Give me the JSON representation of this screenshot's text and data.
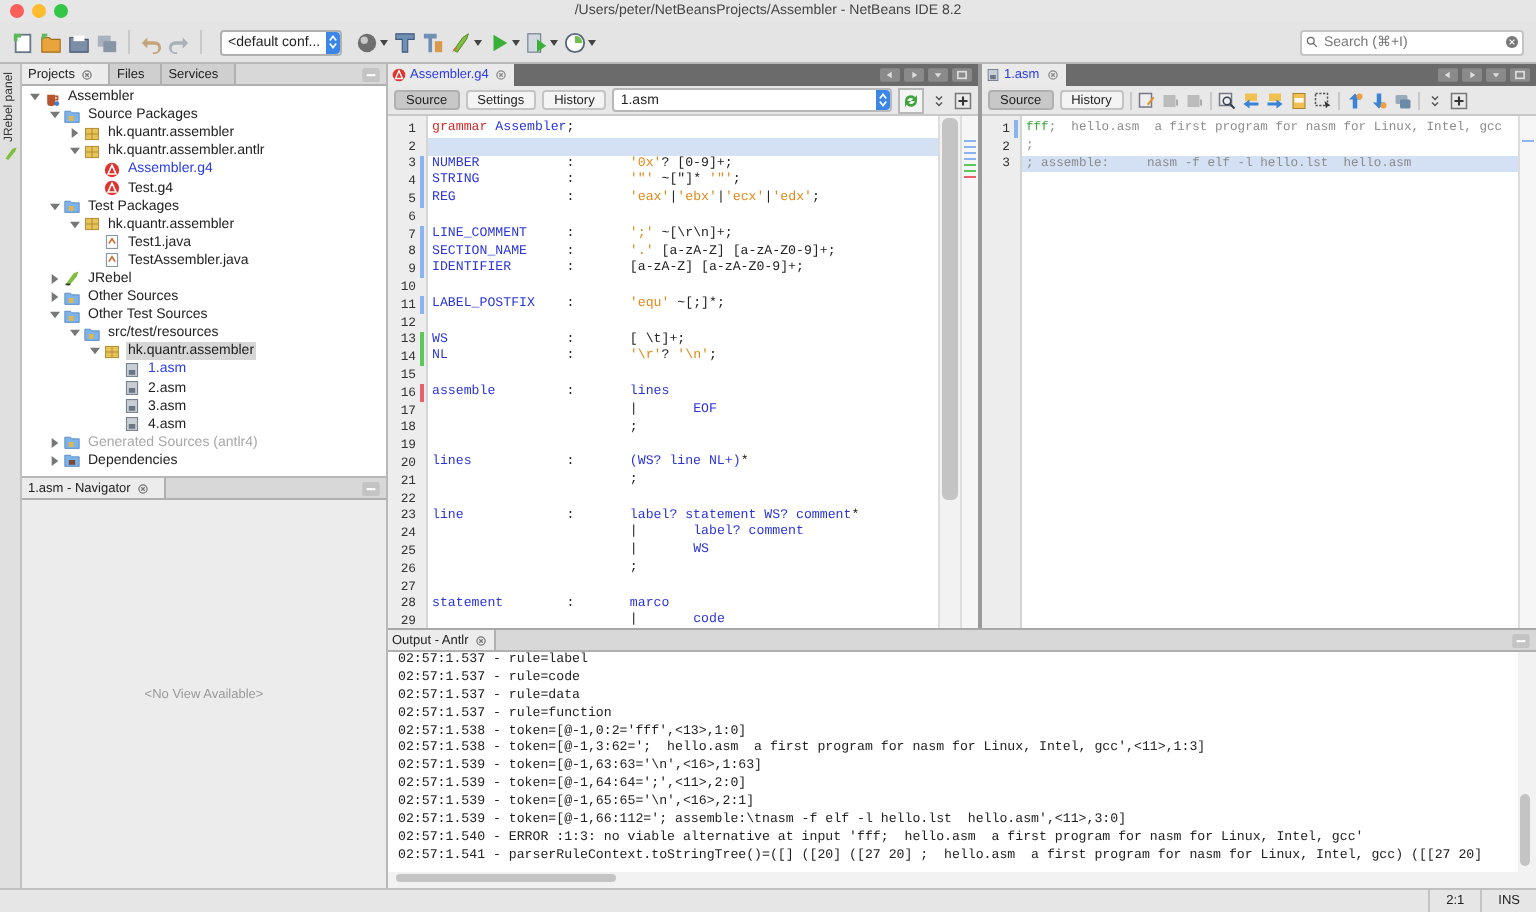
{
  "window": {
    "title": "/Users/peter/NetBeansProjects/Assembler - NetBeans IDE 8.2"
  },
  "toolbar": {
    "configuration": "<default conf...",
    "search": {
      "placeholder": "Search (⌘+I)"
    }
  },
  "side_strip": {
    "label": "JRebel panel"
  },
  "projects_panel": {
    "tabs": [
      {
        "label": "Projects",
        "selected": true
      },
      {
        "label": "Files",
        "selected": false
      },
      {
        "label": "Services",
        "selected": false
      }
    ],
    "tree": [
      {
        "label": "Assembler",
        "kind": "project",
        "expanded": true,
        "selected": false,
        "open": false,
        "disabled": false,
        "children": [
          {
            "label": "Source Packages",
            "kind": "folder",
            "expanded": true,
            "selected": false,
            "open": false,
            "disabled": false,
            "children": [
              {
                "label": "hk.quantr.assembler",
                "kind": "package",
                "expanded": false,
                "selected": false,
                "open": false,
                "disabled": false
              },
              {
                "label": "hk.quantr.assembler.antlr",
                "kind": "package",
                "expanded": true,
                "selected": false,
                "open": false,
                "disabled": false,
                "children": [
                  {
                    "label": "Assembler.g4",
                    "kind": "grammar",
                    "selected": false,
                    "open": true,
                    "disabled": false
                  },
                  {
                    "label": "Test.g4",
                    "kind": "grammar",
                    "selected": false,
                    "open": false,
                    "disabled": false
                  }
                ]
              }
            ]
          },
          {
            "label": "Test Packages",
            "kind": "folder",
            "expanded": true,
            "selected": false,
            "open": false,
            "disabled": false,
            "children": [
              {
                "label": "hk.quantr.assembler",
                "kind": "package",
                "expanded": true,
                "selected": false,
                "open": false,
                "disabled": false,
                "children": [
                  {
                    "label": "Test1.java",
                    "kind": "java",
                    "selected": false,
                    "open": false,
                    "disabled": false
                  },
                  {
                    "label": "TestAssembler.java",
                    "kind": "java",
                    "selected": false,
                    "open": false,
                    "disabled": false
                  }
                ]
              }
            ]
          },
          {
            "label": "JRebel",
            "kind": "jrebel",
            "expanded": false,
            "selected": false,
            "open": false,
            "disabled": false
          },
          {
            "label": "Other Sources",
            "kind": "folder",
            "expanded": false,
            "selected": false,
            "open": false,
            "disabled": false
          },
          {
            "label": "Other Test Sources",
            "kind": "folder",
            "expanded": true,
            "selected": false,
            "open": false,
            "disabled": false,
            "children": [
              {
                "label": "src/test/resources",
                "kind": "folder",
                "expanded": true,
                "selected": false,
                "open": false,
                "disabled": false,
                "children": [
                  {
                    "label": "hk.quantr.assembler",
                    "kind": "package",
                    "expanded": true,
                    "selected": true,
                    "open": false,
                    "disabled": false,
                    "children": [
                      {
                        "label": "1.asm",
                        "kind": "asm",
                        "selected": false,
                        "open": true,
                        "disabled": false
                      },
                      {
                        "label": "2.asm",
                        "kind": "asm",
                        "selected": false,
                        "open": false,
                        "disabled": false
                      },
                      {
                        "label": "3.asm",
                        "kind": "asm",
                        "selected": false,
                        "open": false,
                        "disabled": false
                      },
                      {
                        "label": "4.asm",
                        "kind": "asm",
                        "selected": false,
                        "open": false,
                        "disabled": false
                      }
                    ]
                  }
                ]
              }
            ]
          },
          {
            "label": "Generated Sources (antlr4)",
            "kind": "folder",
            "expanded": false,
            "selected": false,
            "open": false,
            "disabled": true
          },
          {
            "label": "Dependencies",
            "kind": "library",
            "expanded": false,
            "selected": false,
            "open": false,
            "disabled": false
          }
        ]
      }
    ]
  },
  "navigator": {
    "title": "1.asm - Navigator",
    "message": "<No View Available>"
  },
  "editors": [
    {
      "tab": "Assembler.g4",
      "kind": "grammar",
      "views": [
        {
          "label": "Source",
          "selected": true
        },
        {
          "label": "Settings",
          "selected": false
        },
        {
          "label": "History",
          "selected": false
        }
      ],
      "file_selector": "1.asm",
      "lines": [
        {
          "n": "1",
          "current": false,
          "segments": [
            {
              "kind": "keyword",
              "text": "grammar"
            },
            {
              "kind": "name",
              "text": "Assembler"
            },
            {
              "kind": "plain",
              "text": ";"
            }
          ]
        },
        {
          "n": "2",
          "current": true
        },
        {
          "n": "3",
          "current": false,
          "color": "#8ab4f0",
          "name": "NUMBER",
          "colon": ":",
          "segments": [
            {
              "kind": "string",
              "text": "'0x'"
            },
            {
              "kind": "plain",
              "text": "? [0-9]+;"
            }
          ]
        },
        {
          "n": "4",
          "current": false,
          "color": "#8ab4f0",
          "name": "STRING",
          "colon": ":",
          "segments": [
            {
              "kind": "string",
              "text": "'\"'"
            },
            {
              "kind": "plain",
              "text": " ~[\"]* "
            },
            {
              "kind": "string",
              "text": "'\"'"
            },
            {
              "kind": "plain",
              "text": ";"
            }
          ]
        },
        {
          "n": "5",
          "current": false,
          "color": "#8ab4f0",
          "name": "REG",
          "colon": ":",
          "segments": [
            {
              "kind": "string",
              "text": "'eax'"
            },
            {
              "kind": "plain",
              "text": "|"
            },
            {
              "kind": "string",
              "text": "'ebx'"
            },
            {
              "kind": "plain",
              "text": "|"
            },
            {
              "kind": "string",
              "text": "'ecx'"
            },
            {
              "kind": "plain",
              "text": "|"
            },
            {
              "kind": "string",
              "text": "'edx'"
            },
            {
              "kind": "plain",
              "text": ";"
            }
          ]
        },
        {
          "n": "6",
          "current": false
        },
        {
          "n": "7",
          "current": false,
          "color": "#8ab4f0",
          "name": "LINE_COMMENT",
          "colon": ":",
          "segments": [
            {
              "kind": "string",
              "text": "';'"
            },
            {
              "kind": "plain",
              "text": " ~[\\r\\n]+;"
            }
          ]
        },
        {
          "n": "8",
          "current": false,
          "color": "#8ab4f0",
          "name": "SECTION_NAME",
          "colon": ":",
          "segments": [
            {
              "kind": "string",
              "text": "'.'"
            },
            {
              "kind": "plain",
              "text": " [a-zA-Z] [a-zA-Z0-9]+;"
            }
          ]
        },
        {
          "n": "9",
          "current": false,
          "color": "#8ab4f0",
          "name": "IDENTIFIER",
          "colon": ":",
          "segments": [
            {
              "kind": "plain",
              "text": "[a-zA-Z] [a-zA-Z0-9]+;"
            }
          ]
        },
        {
          "n": "10",
          "current": false
        },
        {
          "n": "11",
          "current": false,
          "color": "#8ab4f0",
          "name": "LABEL_POSTFIX",
          "colon": ":",
          "segments": [
            {
              "kind": "string",
              "text": "'equ'"
            },
            {
              "kind": "plain",
              "text": " ~[;]*;"
            }
          ]
        },
        {
          "n": "12",
          "current": false
        },
        {
          "n": "13",
          "current": false,
          "color": "#5cc85c",
          "name": "WS",
          "colon": ":",
          "segments": [
            {
              "kind": "plain",
              "text": "[ \\t]+;"
            }
          ]
        },
        {
          "n": "14",
          "current": false,
          "color": "#5cc85c",
          "name": "NL",
          "colon": ":",
          "segments": [
            {
              "kind": "string",
              "text": "'\\r'"
            },
            {
              "kind": "plain",
              "text": "? "
            },
            {
              "kind": "string",
              "text": "'\\n'"
            },
            {
              "kind": "plain",
              "text": ";"
            }
          ]
        },
        {
          "n": "15",
          "current": false
        },
        {
          "n": "16",
          "current": false,
          "color": "#e8606a",
          "name": "assemble",
          "colon": ":",
          "segments": [
            {
              "kind": "name",
              "text": "lines"
            }
          ]
        },
        {
          "n": "17",
          "current": false,
          "segments": [
            {
              "kind": "plain",
              "text": "|       "
            },
            {
              "kind": "name",
              "text": "EOF"
            }
          ]
        },
        {
          "n": "18",
          "current": false,
          "segments": [
            {
              "kind": "plain",
              "text": ";"
            }
          ]
        },
        {
          "n": "19",
          "current": false
        },
        {
          "n": "20",
          "current": false,
          "name": "lines",
          "colon": ":",
          "segments": [
            {
              "kind": "name",
              "text": "(WS? line NL+)"
            },
            {
              "kind": "plain",
              "text": "*"
            }
          ]
        },
        {
          "n": "21",
          "current": false,
          "segments": [
            {
              "kind": "plain",
              "text": ";"
            }
          ]
        },
        {
          "n": "22",
          "current": false
        },
        {
          "n": "23",
          "current": false,
          "name": "line",
          "colon": ":",
          "segments": [
            {
              "kind": "name",
              "text": "label? statement WS? comment"
            },
            {
              "kind": "plain",
              "text": "*"
            }
          ]
        },
        {
          "n": "24",
          "current": false,
          "segments": [
            {
              "kind": "plain",
              "text": "|       "
            },
            {
              "kind": "name",
              "text": "label? comment"
            }
          ]
        },
        {
          "n": "25",
          "current": false,
          "segments": [
            {
              "kind": "plain",
              "text": "|       "
            },
            {
              "kind": "name",
              "text": "WS"
            }
          ]
        },
        {
          "n": "26",
          "current": false,
          "segments": [
            {
              "kind": "plain",
              "text": ";"
            }
          ]
        },
        {
          "n": "27",
          "current": false
        },
        {
          "n": "28",
          "current": false,
          "name": "statement",
          "colon": ":",
          "segments": [
            {
              "kind": "name",
              "text": "marco"
            }
          ]
        },
        {
          "n": "29",
          "current": false,
          "segments": [
            {
              "kind": "plain",
              "text": "|       "
            },
            {
              "kind": "name",
              "text": "code"
            }
          ]
        }
      ]
    },
    {
      "tab": "1.asm",
      "kind": "asm",
      "views": [
        {
          "label": "Source",
          "selected": true
        },
        {
          "label": "History",
          "selected": false
        }
      ],
      "lines": [
        {
          "n": "1",
          "current": false,
          "color": "#8ab4f0",
          "segments": [
            {
              "kind": "token",
              "text": "fff"
            },
            {
              "kind": "comment",
              "text": ";  hello.asm  a first program for nasm for Linux, Intel, gcc"
            }
          ]
        },
        {
          "n": "2",
          "current": false,
          "segments": [
            {
              "kind": "comment",
              "text": ";"
            }
          ]
        },
        {
          "n": "3",
          "current": true,
          "segments": [
            {
              "kind": "comment",
              "text": "; assemble:     nasm -f elf -l hello.lst  hello.asm"
            }
          ]
        }
      ]
    }
  ],
  "output": {
    "title": "Output - Antlr",
    "lines": [
      "02:57:1.537 - rule=label",
      "02:57:1.537 - rule=code",
      "02:57:1.537 - rule=data",
      "02:57:1.537 - rule=function",
      "02:57:1.538 - token=[@-1,0:2='fff',<13>,1:0]",
      "02:57:1.538 - token=[@-1,3:62=';  hello.asm  a first program for nasm for Linux, Intel, gcc',<11>,1:3]",
      "02:57:1.539 - token=[@-1,63:63='\\n',<16>,1:63]",
      "02:57:1.539 - token=[@-1,64:64=';',<11>,2:0]",
      "02:57:1.539 - token=[@-1,65:65='\\n',<16>,2:1]",
      "02:57:1.539 - token=[@-1,66:112='; assemble:\\tnasm -f elf -l hello.lst  hello.asm',<11>,3:0]",
      "02:57:1.540 - ERROR :1:3: no viable alternative at input 'fff;  hello.asm  a first program for nasm for Linux, Intel, gcc'",
      "02:57:1.541 - parserRuleContext.toStringTree()=([] ([20] ([27 20] ;  hello.asm  a first program for nasm for Linux, Intel, gcc) ([[27 20]"
    ]
  },
  "status_bar": {
    "position": "2:1",
    "mode": "INS"
  }
}
